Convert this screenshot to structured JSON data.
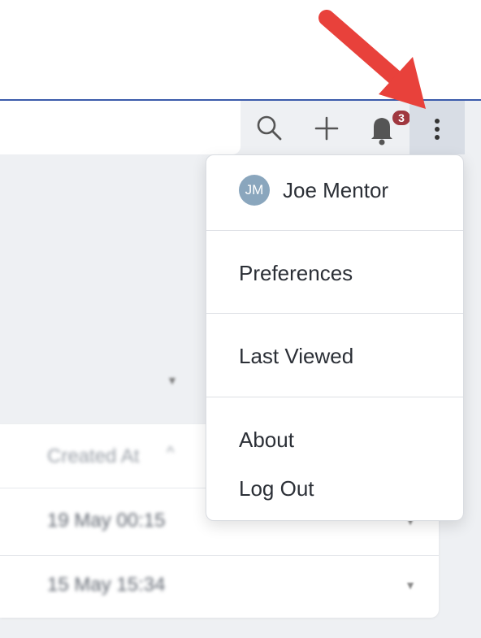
{
  "header": {
    "notification_count": "3",
    "icons": [
      "search-icon",
      "plus-icon",
      "bell-icon",
      "kebab-menu-icon"
    ]
  },
  "user_menu": {
    "avatar_initials": "JM",
    "user_name": "Joe Mentor",
    "items": [
      "Preferences",
      "Last Viewed",
      "About",
      "Log Out"
    ]
  },
  "table": {
    "column_header": "Created At",
    "rows": [
      "19 May 00:15",
      "15 May 15:34"
    ]
  },
  "colors": {
    "accent_line": "#3b5bab",
    "badge": "#a0383f",
    "annotation_arrow": "#e8413b"
  }
}
